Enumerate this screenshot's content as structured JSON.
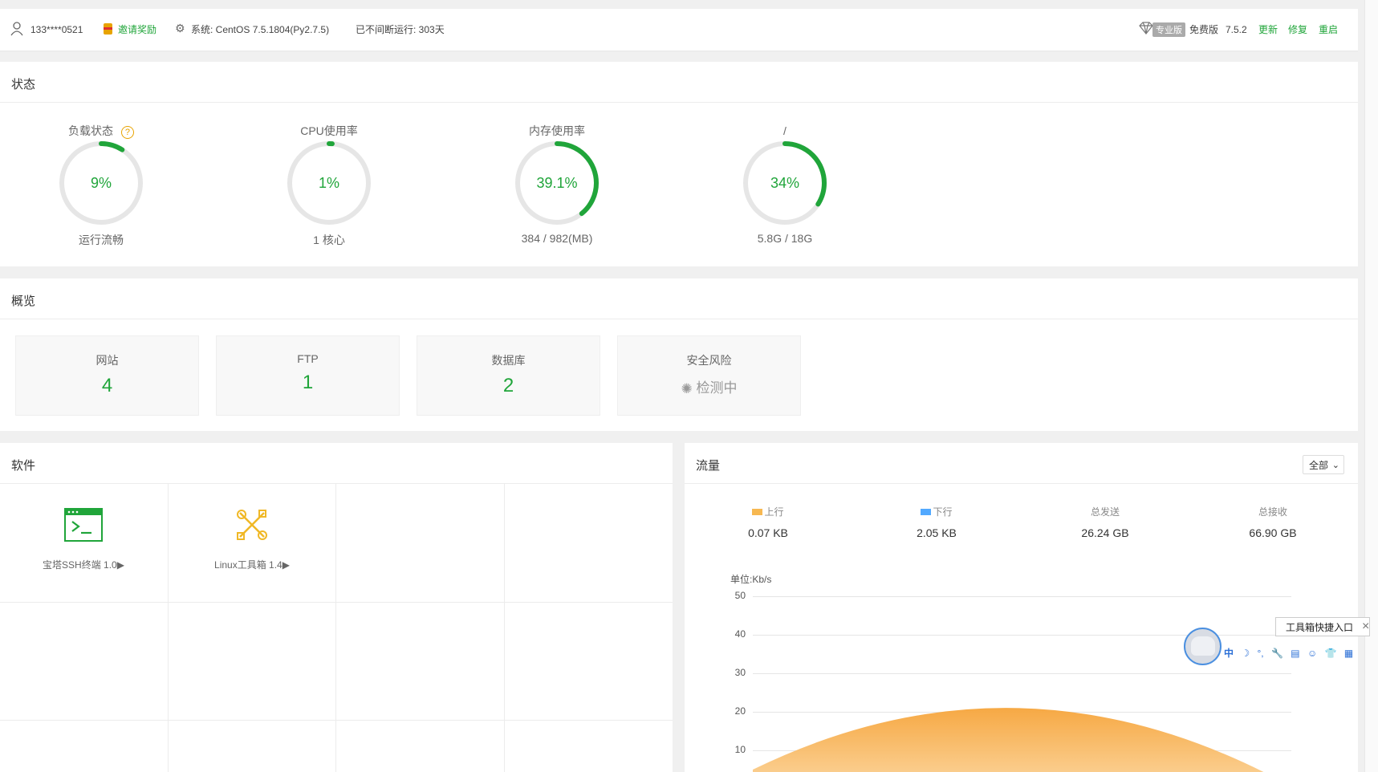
{
  "topbar": {
    "user": "133****0521",
    "invite": "邀请奖励",
    "system": "系统: CentOS 7.5.1804(Py2.7.5)",
    "uptime": "已不间断运行: 303天",
    "pro_badge": "专业版",
    "edition": "免费版",
    "version": "7.5.2",
    "update": "更新",
    "repair": "修复",
    "restart": "重启"
  },
  "status": {
    "title": "状态",
    "gauges": [
      {
        "label": "负载状态",
        "value": "9%",
        "sub": "运行流畅",
        "percent": 9
      },
      {
        "label": "CPU使用率",
        "value": "1%",
        "sub": "1 核心",
        "percent": 1
      },
      {
        "label": "内存使用率",
        "value": "39.1%",
        "sub": "384 / 982(MB)",
        "percent": 39.1
      },
      {
        "label": "/",
        "value": "34%",
        "sub": "5.8G / 18G",
        "percent": 34
      }
    ]
  },
  "overview": {
    "title": "概览",
    "cards": [
      {
        "name": "网站",
        "value": "4"
      },
      {
        "name": "FTP",
        "value": "1"
      },
      {
        "name": "数据库",
        "value": "2"
      },
      {
        "name": "安全风险",
        "value": "检测中"
      }
    ]
  },
  "software": {
    "title": "软件",
    "items": [
      {
        "name": "宝塔SSH终端 1.0▶",
        "icon": "terminal-icon"
      },
      {
        "name": "Linux工具箱 1.4▶",
        "icon": "tools-icon"
      }
    ]
  },
  "traffic": {
    "title": "流量",
    "select": "全部",
    "stats": [
      {
        "label": "上行",
        "value": "0.07 KB",
        "color": "#f7b851"
      },
      {
        "label": "下行",
        "value": "2.05 KB",
        "color": "#52a9ff"
      },
      {
        "label": "总发送",
        "value": "26.24 GB"
      },
      {
        "label": "总接收",
        "value": "66.90 GB"
      }
    ],
    "unit": "单位:Kb/s",
    "yticks": [
      "50",
      "40",
      "30",
      "20",
      "10"
    ]
  },
  "floating": {
    "toolbox_label": "工具箱快捷入口",
    "ime_chars": [
      "中",
      "☽",
      "°,",
      "🔧",
      "▤",
      "☺",
      "👕",
      "▦",
      "🔒"
    ]
  },
  "chart_data": {
    "type": "area",
    "ylabel": "单位:Kb/s",
    "ylim": [
      0,
      50
    ],
    "yticks": [
      50,
      40,
      30,
      20,
      10
    ],
    "series": [
      {
        "name": "上行",
        "color": "#f7b851",
        "values": [
          5,
          21,
          4
        ]
      },
      {
        "name": "下行",
        "color": "#52a9ff",
        "values": [
          0.5,
          1,
          0.5
        ]
      }
    ]
  }
}
